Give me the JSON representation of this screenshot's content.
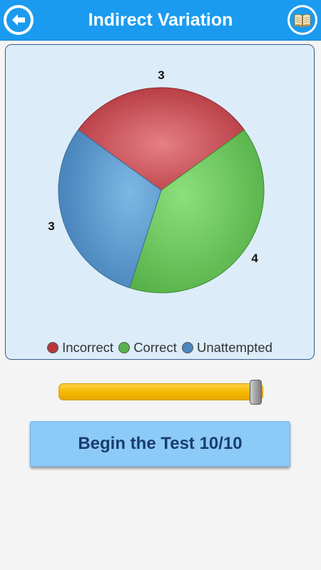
{
  "header": {
    "title": "Indirect Variation",
    "back_icon": "back-arrow-icon",
    "book_icon": "book-icon"
  },
  "colors": {
    "app_bar": "#1a9bf0",
    "panel_bg": "#dcedf9",
    "incorrect": "#c2474f",
    "correct": "#63bf55",
    "unattempted": "#5597cc",
    "slider": "#f5b700",
    "button": "#8ccbf8"
  },
  "chart_data": {
    "type": "pie",
    "categories": [
      "Incorrect",
      "Correct",
      "Unattempted"
    ],
    "values": [
      3,
      4,
      3
    ],
    "legend_position": "bottom"
  },
  "legend": {
    "items": [
      "Incorrect",
      "Correct",
      "Unattempted"
    ]
  },
  "slider": {
    "value": 10,
    "max": 10
  },
  "begin_button": {
    "label": "Begin the Test 10/10"
  }
}
